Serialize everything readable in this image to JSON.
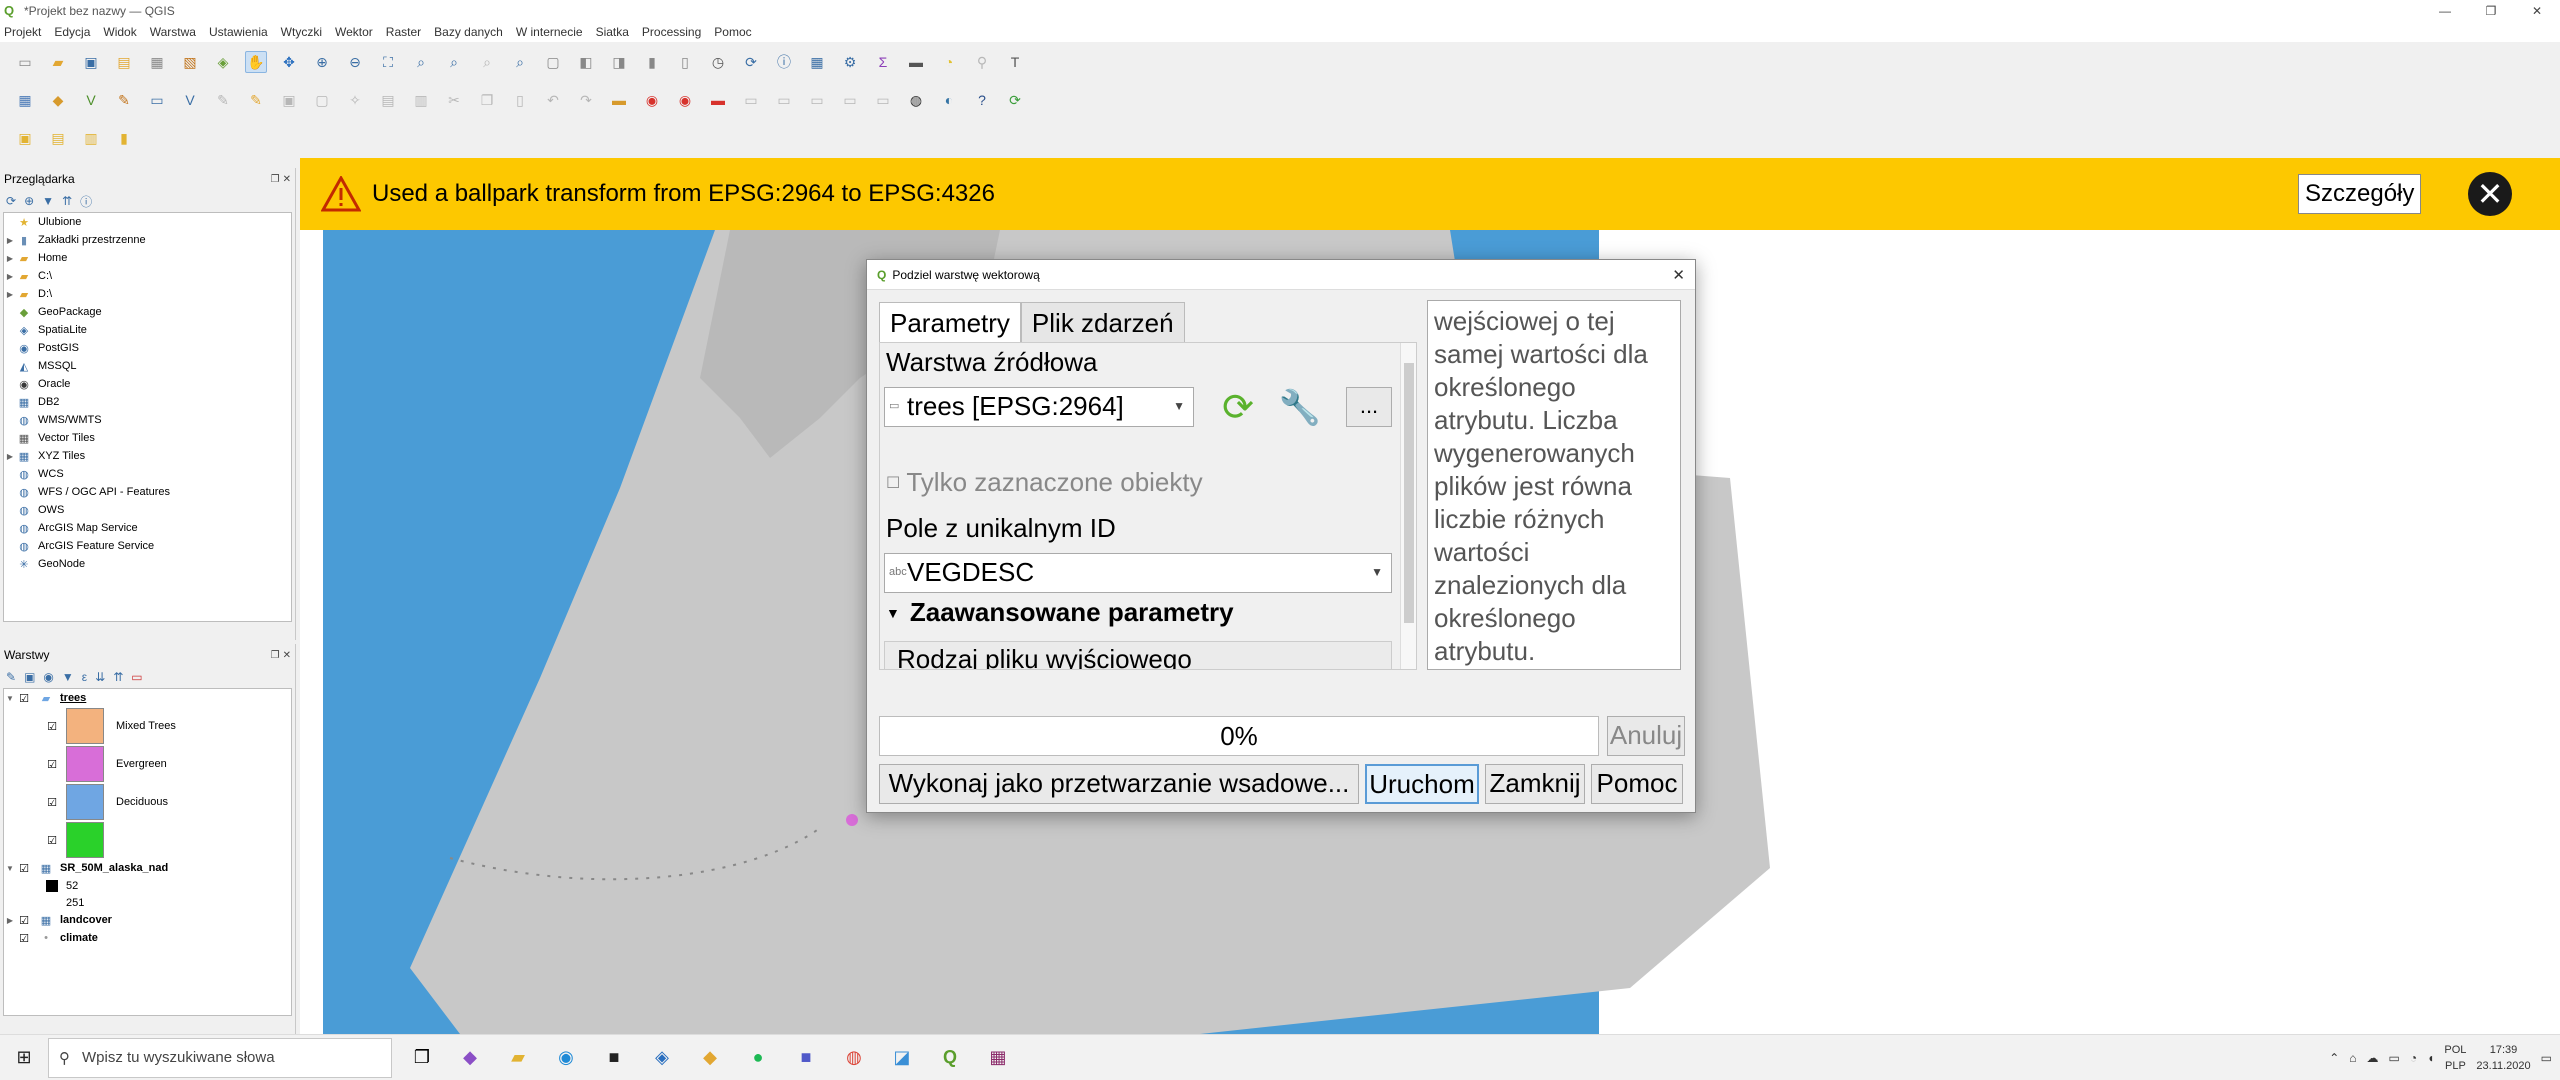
{
  "window": {
    "title": "*Projekt bez nazwy — QGIS",
    "controls": [
      "—",
      "❐",
      "✕"
    ]
  },
  "menu": [
    "Projekt",
    "Edycja",
    "Widok",
    "Warstwa",
    "Ustawienia",
    "Wtyczki",
    "Wektor",
    "Raster",
    "Bazy danych",
    "W internecie",
    "Siatka",
    "Processing",
    "Pomoc"
  ],
  "browser": {
    "title": "Przeglądarka",
    "items": [
      {
        "label": "Ulubione",
        "icon": "star-icon",
        "expand": false
      },
      {
        "label": "Zakładki przestrzenne",
        "icon": "bookmark-icon",
        "expand": true
      },
      {
        "label": "Home",
        "icon": "folder-icon",
        "expand": true
      },
      {
        "label": "C:\\",
        "icon": "folder-icon",
        "expand": true
      },
      {
        "label": "D:\\",
        "icon": "folder-icon",
        "expand": true
      },
      {
        "label": "GeoPackage",
        "icon": "geopackage-icon",
        "expand": false
      },
      {
        "label": "SpatiaLite",
        "icon": "spatialite-icon",
        "expand": false
      },
      {
        "label": "PostGIS",
        "icon": "postgis-icon",
        "expand": false
      },
      {
        "label": "MSSQL",
        "icon": "mssql-icon",
        "expand": false
      },
      {
        "label": "Oracle",
        "icon": "oracle-icon",
        "expand": false
      },
      {
        "label": "DB2",
        "icon": "db2-icon",
        "expand": false
      },
      {
        "label": "WMS/WMTS",
        "icon": "wms-icon",
        "expand": false
      },
      {
        "label": "Vector Tiles",
        "icon": "vector-tiles-icon",
        "expand": false
      },
      {
        "label": "XYZ Tiles",
        "icon": "xyz-tiles-icon",
        "expand": true
      },
      {
        "label": "WCS",
        "icon": "wcs-icon",
        "expand": false
      },
      {
        "label": "WFS / OGC API - Features",
        "icon": "wfs-icon",
        "expand": false
      },
      {
        "label": "OWS",
        "icon": "ows-icon",
        "expand": false
      },
      {
        "label": "ArcGIS Map Service",
        "icon": "arcgis-icon",
        "expand": false
      },
      {
        "label": "ArcGIS Feature Service",
        "icon": "arcgis-icon",
        "expand": false
      },
      {
        "label": "GeoNode",
        "icon": "geonode-icon",
        "expand": false
      }
    ]
  },
  "layers_panel": {
    "title": "Warstwy",
    "layers": [
      {
        "name": "trees",
        "bold": true,
        "underline": true
      },
      {
        "name": "SR_50M_alaska_nad",
        "bold": true
      },
      {
        "name": "landcover",
        "bold": true
      },
      {
        "name": "climate",
        "bold": true
      }
    ],
    "tree_classes": [
      {
        "label": "Mixed Trees",
        "color": "#f3b27e"
      },
      {
        "label": "Evergreen",
        "color": "#d86ed8"
      },
      {
        "label": "Deciduous",
        "color": "#6fa6e3"
      },
      {
        "label": "",
        "color": "#2ad12a"
      }
    ],
    "raster_values": [
      "52",
      "251"
    ]
  },
  "message_bar": {
    "text": "Used a ballpark transform from EPSG:2964 to EPSG:4326",
    "details_label": "Szczegóły",
    "close_glyph": "✕"
  },
  "dialog": {
    "title": "Podziel warstwę wektorową",
    "close_glyph": "✕",
    "tabs": [
      "Parametry",
      "Plik zdarzeń"
    ],
    "source_layer_label": "Warstwa źródłowa",
    "source_layer_value": "trees [EPSG:2964]",
    "ellipsis_label": "...",
    "selected_only_label": "Tylko zaznaczone obiekty",
    "unique_field_label": "Pole z unikalnym ID",
    "unique_field_prefix": "abc",
    "unique_field_value": "VEGDESC",
    "advanced_label": "Zaawansowane parametry",
    "output_type_label": "Rodzaj pliku wyjściowego",
    "help_text": "wejściowej o tej samej wartości dla określonego atrybutu. Liczba wygenerowanych plików jest równa liczbie różnych wartości znalezionych dla określonego atrybutu.",
    "progress_text": "0%",
    "cancel_label": "Anuluj",
    "batch_label": "Wykonaj jako przetwarzanie wsadowe...",
    "run_label": "Uruchom",
    "close_label": "Zamknij",
    "help_label": "Pomoc"
  },
  "taskbar": {
    "search_placeholder": "Wpisz tu wyszukiwane słowa",
    "lang_top": "POL",
    "lang_bottom": "PLP",
    "time": "17:39",
    "date": "23.11.2020"
  },
  "colors": {
    "message_bar": "#fdc800",
    "map_water": "#4a9cd6",
    "hillshade": "#c8c8c8"
  }
}
